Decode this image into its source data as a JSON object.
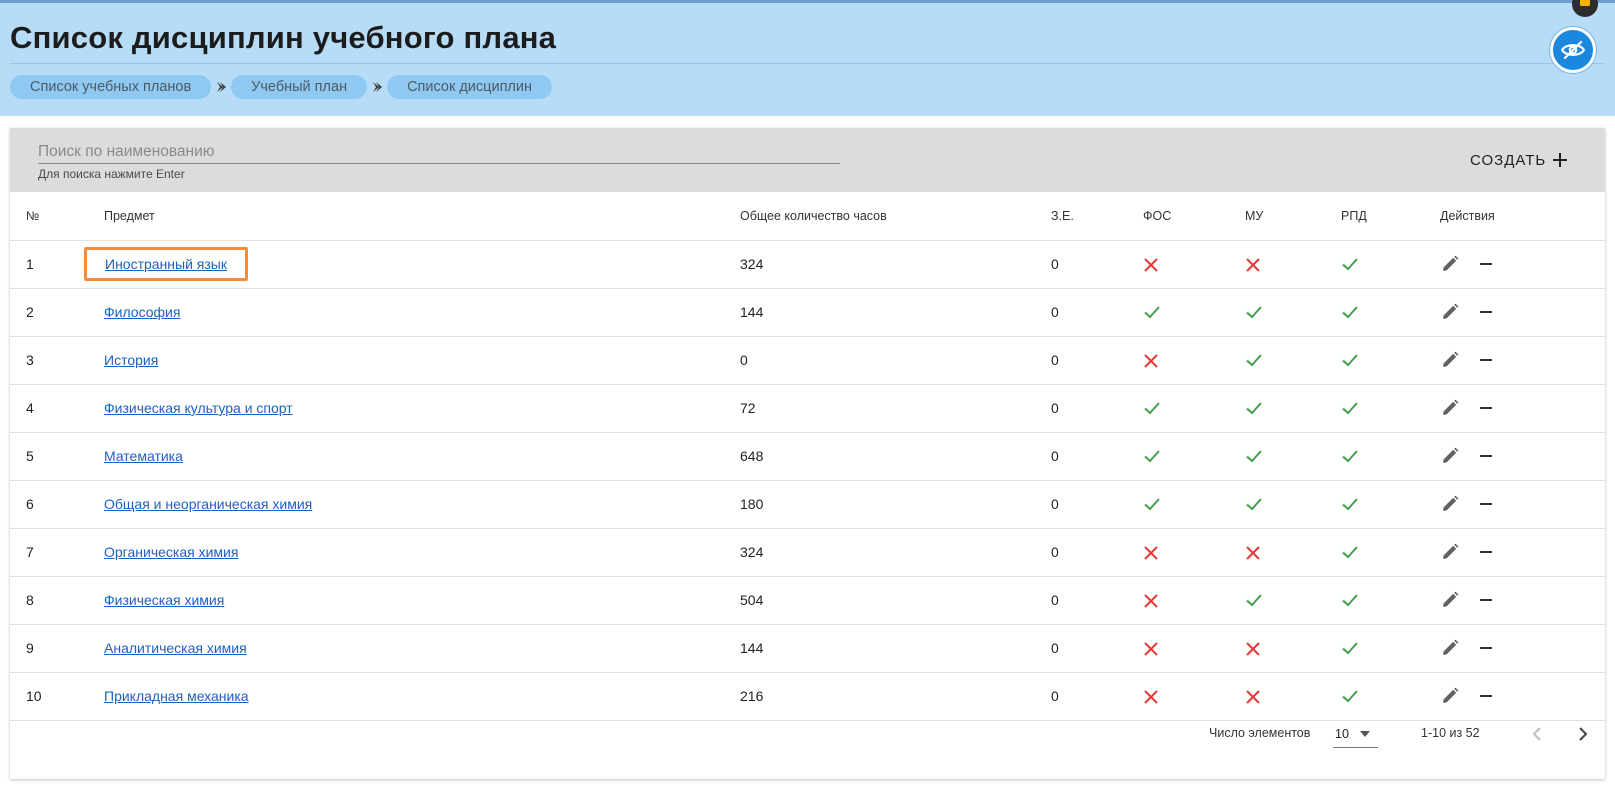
{
  "header": {
    "title": "Список дисциплин учебного плана",
    "breadcrumbs": [
      "Список учебных планов",
      "Учебный план",
      "Список дисциплин"
    ],
    "background_color": "#b7dcf7",
    "visibility_icon": "eye-off-icon",
    "chat_icon": "chat-icon"
  },
  "toolbar": {
    "search_placeholder": "Поиск по наименованию",
    "search_value": "",
    "search_hint": "Для поиска нажмите Enter",
    "create_label": "СОЗДАТЬ",
    "create_icon": "plus-icon"
  },
  "table": {
    "columns": [
      "№",
      "Предмет",
      "Общее количество часов",
      "З.Е.",
      "ФОС",
      "МУ",
      "РПД",
      "Действия"
    ],
    "rows": [
      {
        "num": "1",
        "subject": "Иностранный язык",
        "hours": "324",
        "ze": "0",
        "fos": false,
        "mu": false,
        "rpd": true
      },
      {
        "num": "2",
        "subject": "Философия",
        "hours": "144",
        "ze": "0",
        "fos": true,
        "mu": true,
        "rpd": true
      },
      {
        "num": "3",
        "subject": "История",
        "hours": "0",
        "ze": "0",
        "fos": false,
        "mu": true,
        "rpd": true
      },
      {
        "num": "4",
        "subject": "Физическая культура и спорт",
        "hours": "72",
        "ze": "0",
        "fos": true,
        "mu": true,
        "rpd": true
      },
      {
        "num": "5",
        "subject": "Математика",
        "hours": "648",
        "ze": "0",
        "fos": true,
        "mu": true,
        "rpd": true
      },
      {
        "num": "6",
        "subject": "Общая и неорганическая химия",
        "hours": "180",
        "ze": "0",
        "fos": true,
        "mu": true,
        "rpd": true
      },
      {
        "num": "7",
        "subject": "Органическая химия",
        "hours": "324",
        "ze": "0",
        "fos": false,
        "mu": false,
        "rpd": true
      },
      {
        "num": "8",
        "subject": "Физическая химия",
        "hours": "504",
        "ze": "0",
        "fos": false,
        "mu": true,
        "rpd": true
      },
      {
        "num": "9",
        "subject": "Аналитическая химия",
        "hours": "144",
        "ze": "0",
        "fos": false,
        "mu": false,
        "rpd": true
      },
      {
        "num": "10",
        "subject": "Прикладная механика",
        "hours": "216",
        "ze": "0",
        "fos": false,
        "mu": false,
        "rpd": true
      }
    ],
    "highlighted_row": 0,
    "colors": {
      "check": "#43a047",
      "cross": "#e53935",
      "link": "#1565c0",
      "highlight": "#f58b3c"
    }
  },
  "pagination": {
    "rows_per_page_label": "Число элементов",
    "rows_per_page_value": "10",
    "range_label": "1-10 из 52"
  }
}
